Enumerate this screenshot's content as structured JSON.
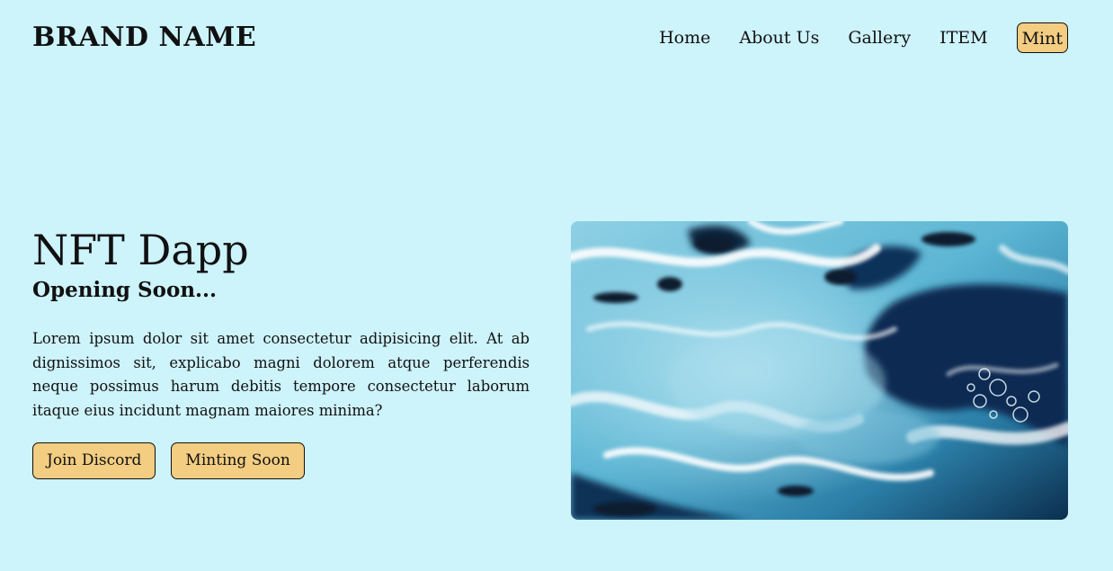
{
  "header": {
    "brand": "BRAND NAME",
    "nav": [
      "Home",
      "About Us",
      "Gallery",
      "ITEM"
    ],
    "mint": "Mint"
  },
  "hero": {
    "title": "NFT Dapp",
    "subtitle": "Opening Soon...",
    "body": "Lorem ipsum dolor sit amet consectetur adipisicing elit. At ab dignissimos sit, explicabo magni dolorem atque perferendis neque possimus harum debitis tempore consectetur laborum itaque eius incidunt magnam maiores minima?",
    "buttons": [
      "Join Discord",
      "Minting Soon"
    ]
  },
  "colors": {
    "background": "#cdf3fb",
    "button": "#f2cd82",
    "text": "#111111"
  }
}
